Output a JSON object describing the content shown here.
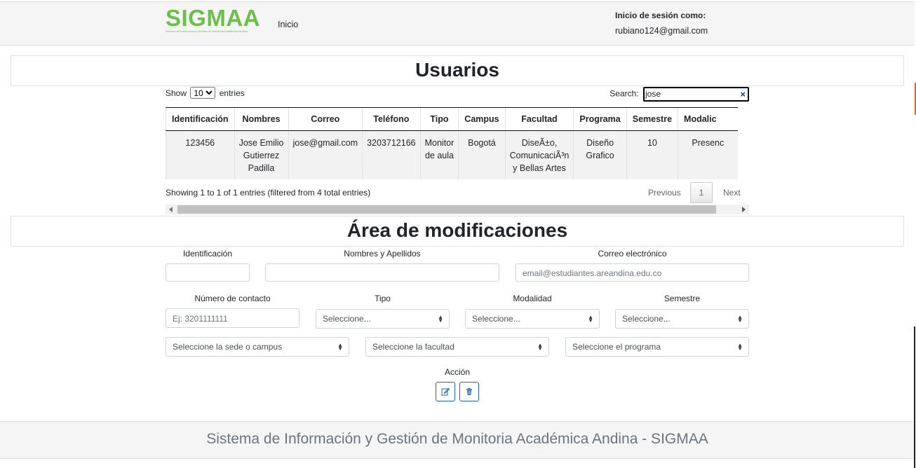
{
  "header": {
    "logo_text": "SIGMAA",
    "logo_subtitle": "Sistema de Información y Gestión de Monitoria Académica Andina",
    "nav_inicio": "Inicio",
    "login_label": "Inicio de sesión como:",
    "login_email": "rubiano124@gmail.com"
  },
  "users_section": {
    "title": "Usuarios"
  },
  "datatable": {
    "show_label": "Show",
    "page_size": "10",
    "entries_label": "entries",
    "search_label": "Search:",
    "search_value": "jose",
    "columns": [
      "Identificación",
      "Nombres",
      "Correo",
      "Teléfono",
      "Tipo",
      "Campus",
      "Facultad",
      "Programa",
      "Semestre",
      "Modalic"
    ],
    "rows": [
      {
        "identificacion": "123456",
        "nombres": [
          "Jose Emilio",
          "Gutierrez",
          "Padilla"
        ],
        "correo": "jose@gmail.com",
        "telefono": "3203712166",
        "tipo": [
          "Monitor",
          "de aula"
        ],
        "campus": "Bogotá",
        "facultad": [
          "DiseÃ±o,",
          "ComunicaciÃ³n",
          "y Bellas Artes"
        ],
        "programa": [
          "Diseño",
          "Grafico"
        ],
        "semestre": "10",
        "modalidad": "Presenc"
      }
    ],
    "info": "Showing 1 to 1 of 1 entries (filtered from 4 total entries)",
    "pagination": {
      "previous": "Previous",
      "current": "1",
      "next": "Next"
    }
  },
  "mod_section": {
    "title": "Área de modificaciones"
  },
  "form": {
    "identificacion_label": "Identificación",
    "identificacion_value": "",
    "nombres_label": "Nombres y Apellidos",
    "nombres_value": "",
    "correo_label": "Correo electrónico",
    "correo_placeholder": "email@estudiantes.areandina.edu.co",
    "contacto_label": "Número de contacto",
    "contacto_placeholder": "Ej: 3201111111",
    "tipo_label": "Tipo",
    "tipo_value": "Seleccione...",
    "modalidad_label": "Modalidad",
    "modalidad_value": "Seleccione...",
    "semestre_label": "Semestre",
    "semestre_value": "Seleccione...",
    "sede_value": "Seleccione la sede o campus",
    "facultad_value": "Seleccione la facultad",
    "programa_value": "Seleccione el programa",
    "accion_label": "Acción"
  },
  "actions": {
    "edit_icon": "edit-icon",
    "delete_icon": "trash-icon"
  },
  "footer": {
    "text": "Sistema de Información y Gestión de Monitoria Académica Andina - SIGMAA"
  },
  "colors": {
    "brand_green": "#6cc04a",
    "action_blue": "#1c6ab2",
    "footer_text": "#6c757d"
  }
}
